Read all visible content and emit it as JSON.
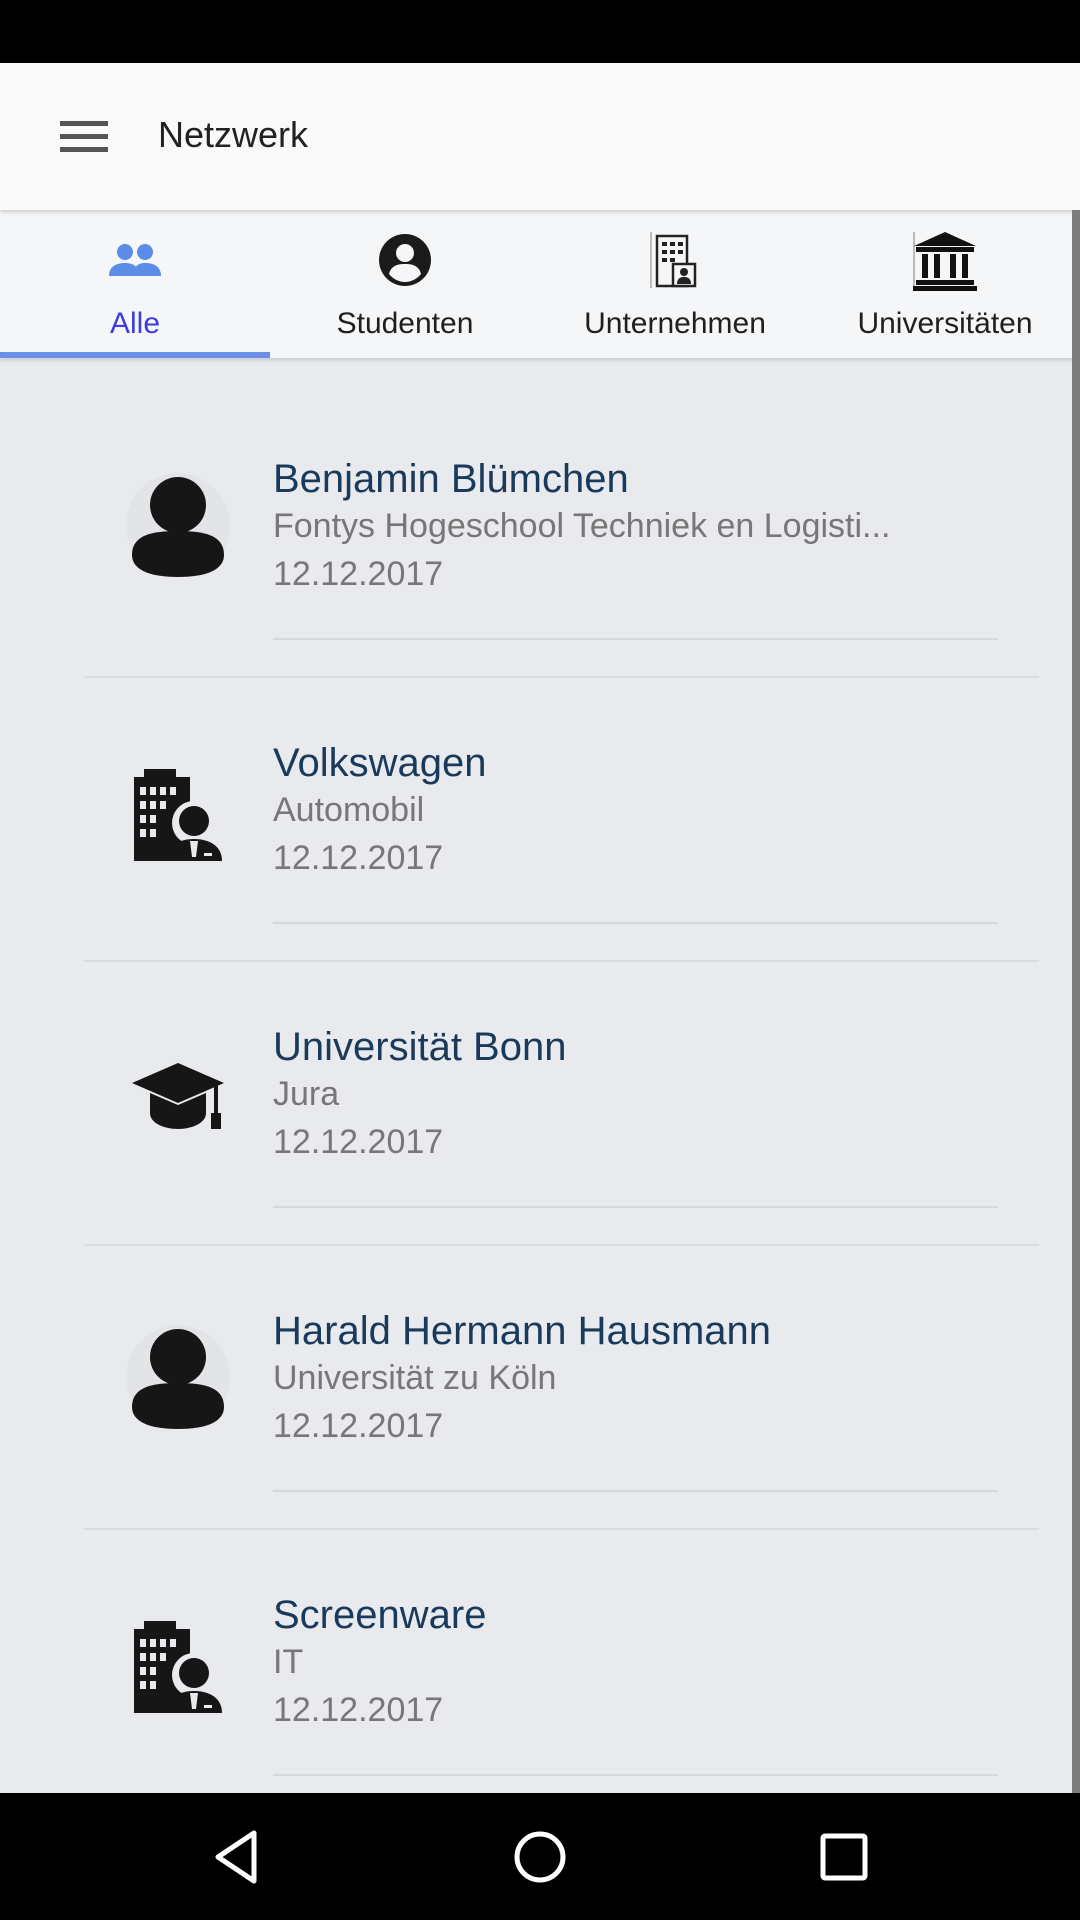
{
  "app_bar": {
    "title": "Netzwerk",
    "menu_icon": "menu-icon"
  },
  "tabs": [
    {
      "label": "Alle",
      "icon": "people-icon",
      "active": true
    },
    {
      "label": "Studenten",
      "icon": "account-circle-icon",
      "active": false
    },
    {
      "label": "Unternehmen",
      "icon": "office-building-icon",
      "active": false
    },
    {
      "label": "Universitäten",
      "icon": "institution-icon",
      "active": false
    }
  ],
  "colors": {
    "active_tab": "#3d3dde",
    "indicator": "#6b8ee6",
    "name_text": "#1a3a5c",
    "secondary_text": "#777777",
    "background": "#e8eaee"
  },
  "contacts": [
    {
      "name": "Benjamin Blümchen",
      "subtitle": "Fontys Hogeschool Techniek en Logisti...",
      "date": "12.12.2017",
      "icon": "person-icon"
    },
    {
      "name": "Volkswagen",
      "subtitle": "Automobil",
      "date": "12.12.2017",
      "icon": "company-icon"
    },
    {
      "name": "Universität Bonn",
      "subtitle": "Jura",
      "date": "12.12.2017",
      "icon": "graduation-cap-icon"
    },
    {
      "name": "Harald Hermann Hausmann",
      "subtitle": "Universität zu Köln",
      "date": "12.12.2017",
      "icon": "person-icon"
    },
    {
      "name": "Screenware",
      "subtitle": "IT",
      "date": "12.12.2017",
      "icon": "company-icon"
    }
  ],
  "nav": {
    "back_icon": "back-triangle-icon",
    "home_icon": "home-circle-icon",
    "recents_icon": "recents-square-icon"
  }
}
